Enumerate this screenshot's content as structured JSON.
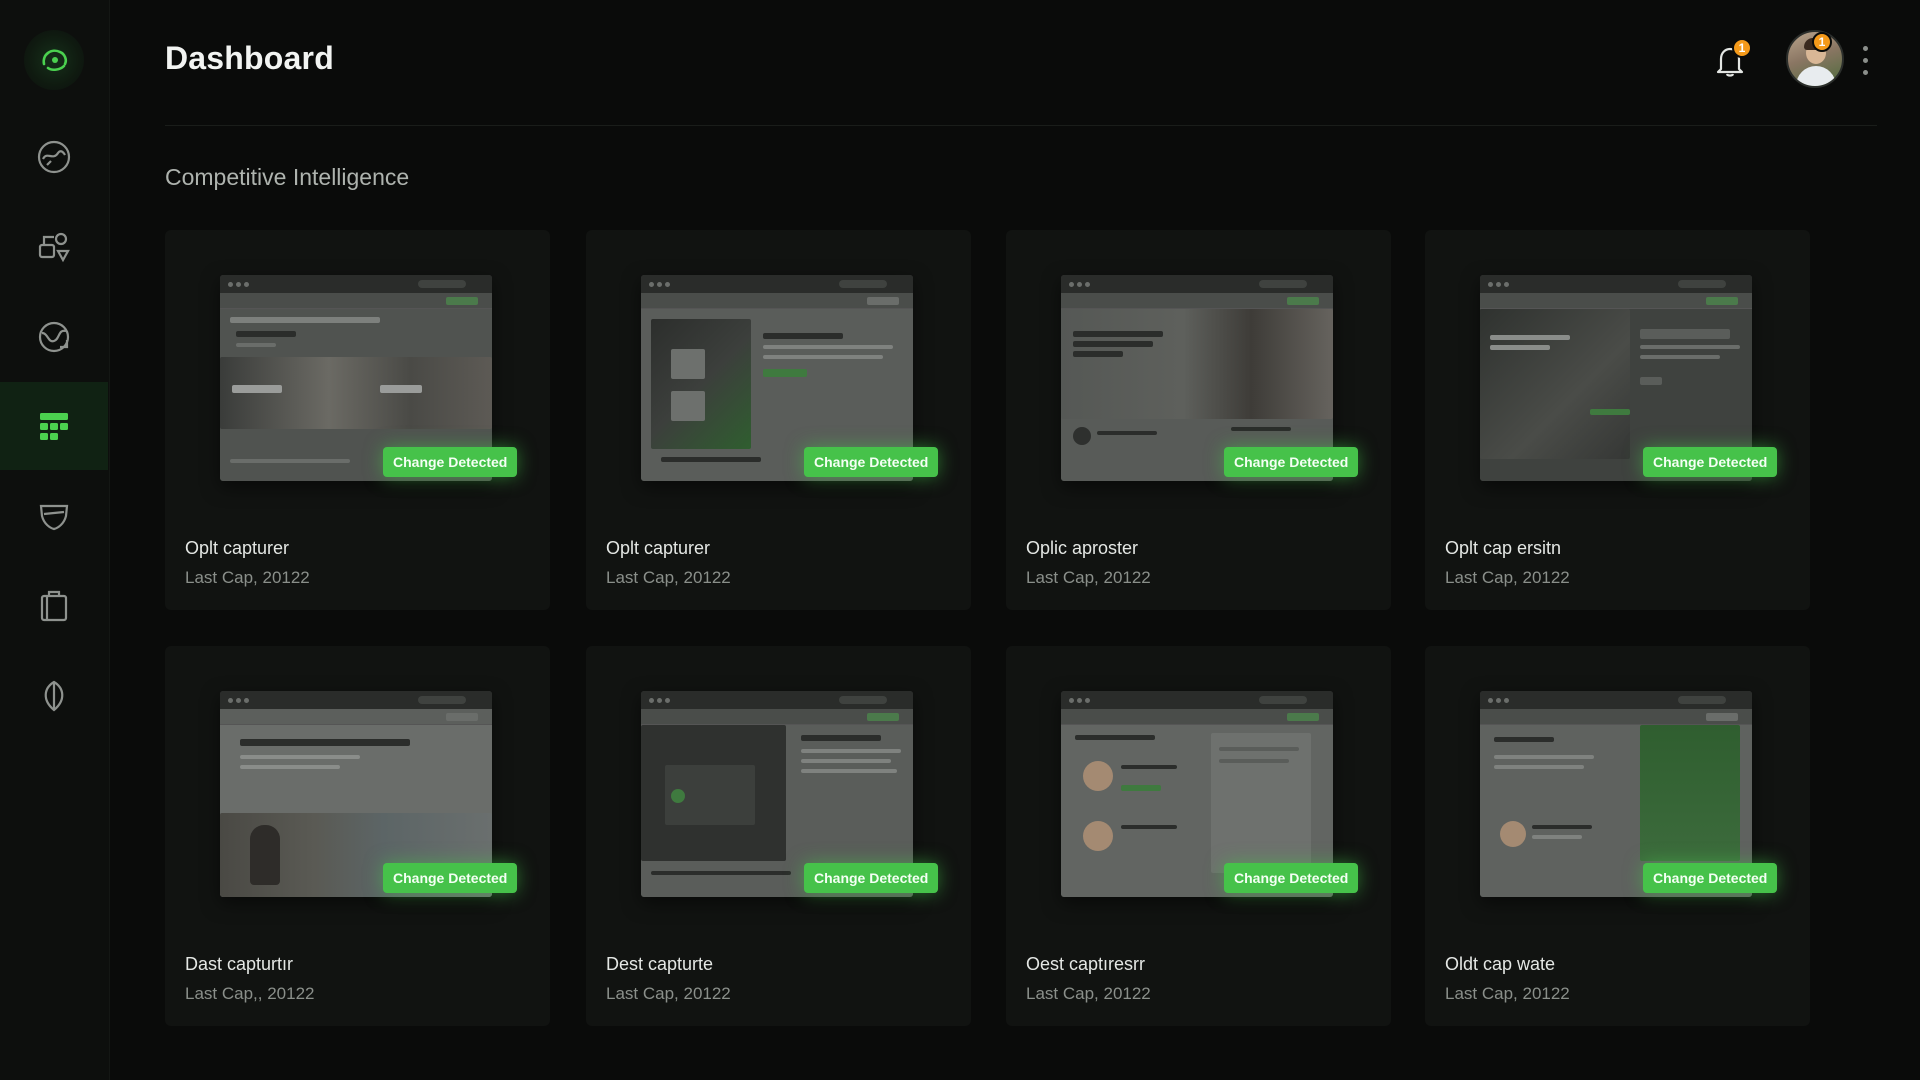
{
  "header": {
    "title": "Dashboard",
    "notification_count": "1",
    "avatar_badge": "1"
  },
  "section": {
    "title": "Competitive Intelligence"
  },
  "sidebar": {
    "items": [
      {
        "icon": "refresh-globe-icon"
      },
      {
        "icon": "shapes-icon"
      },
      {
        "icon": "globe-sync-icon"
      },
      {
        "icon": "dashboard-grid-icon",
        "active": true
      },
      {
        "icon": "shield-icon"
      },
      {
        "icon": "clipboard-icon"
      },
      {
        "icon": "leaf-icon"
      }
    ]
  },
  "cards": [
    {
      "title": "Oplt capturer",
      "subtitle": "Last Cap, 20122",
      "badge": "Change Detected"
    },
    {
      "title": "Oplt capturer",
      "subtitle": "Last Cap, 20122",
      "badge": "Change Detected"
    },
    {
      "title": "Oplic aproster",
      "subtitle": "Last Cap, 20122",
      "badge": "Change Detected"
    },
    {
      "title": "Oplt cap ersitn",
      "subtitle": "Last Cap, 20122",
      "badge": "Change Detected"
    },
    {
      "title": "Dast capturtır",
      "subtitle": "Last Cap,, 20122",
      "badge": "Change Detected"
    },
    {
      "title": "Dest capturte",
      "subtitle": "Last Cap, 20122",
      "badge": "Change Detected"
    },
    {
      "title": "Oest captıresrr",
      "subtitle": "Last Cap, 20122",
      "badge": "Change Detected"
    },
    {
      "title": "Oldt cap wate",
      "subtitle": "Last Cap, 20122",
      "badge": "Change Detected"
    }
  ],
  "colors": {
    "accent": "#46c24a",
    "background": "#0a0b0a",
    "card": "#111311",
    "badge_orange": "#f59a1a"
  }
}
